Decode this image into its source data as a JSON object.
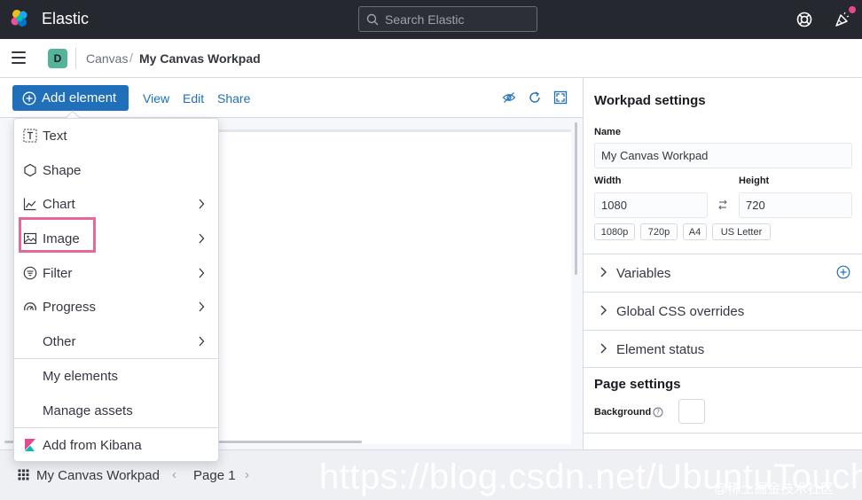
{
  "app": {
    "brand": "Elastic",
    "search_placeholder": "Search Elastic"
  },
  "breadcrumb": {
    "space_initial": "D",
    "space_color": "#54b399",
    "items": [
      "Canvas",
      "My Canvas Workpad"
    ],
    "separator": "/"
  },
  "toolbar": {
    "add_element_label": "Add element",
    "links": [
      "View",
      "Edit",
      "Share"
    ],
    "icons": [
      "eye-closed-icon",
      "refresh-icon",
      "fullscreen-icon"
    ],
    "accent": "#1f6fba"
  },
  "add_menu": {
    "items": [
      {
        "label": "Text",
        "icon": "text-icon",
        "submenu": false
      },
      {
        "label": "Shape",
        "icon": "hexagon-icon",
        "submenu": false
      },
      {
        "label": "Chart",
        "icon": "chart-icon",
        "submenu": true
      },
      {
        "label": "Image",
        "icon": "image-icon",
        "submenu": true,
        "highlighted": true
      },
      {
        "label": "Filter",
        "icon": "filter-icon",
        "submenu": true
      },
      {
        "label": "Progress",
        "icon": "gauge-icon",
        "submenu": true
      },
      {
        "label": "Other",
        "icon": "",
        "submenu": true
      }
    ],
    "extra": [
      "My elements",
      "Manage assets"
    ],
    "from_kibana": "Add from Kibana",
    "highlight_color": "#e8679a"
  },
  "workpad_settings": {
    "title": "Workpad settings",
    "name_label": "Name",
    "name_value": "My Canvas Workpad",
    "width_label": "Width",
    "width_value": "1080",
    "height_label": "Height",
    "height_value": "720",
    "presets": [
      "1080p",
      "720p",
      "A4",
      "US Letter"
    ],
    "sections": [
      "Variables",
      "Global CSS overrides",
      "Element status"
    ]
  },
  "page_settings": {
    "title": "Page settings",
    "background_label": "Background"
  },
  "footer": {
    "workpad_title": "My Canvas Workpad",
    "page_label": "Page 1",
    "prev": "‹",
    "next": "›"
  },
  "watermark": {
    "url": "https://blog.csdn.net/UbuntuTouch",
    "credit": "@稀土掘金技术社区"
  }
}
